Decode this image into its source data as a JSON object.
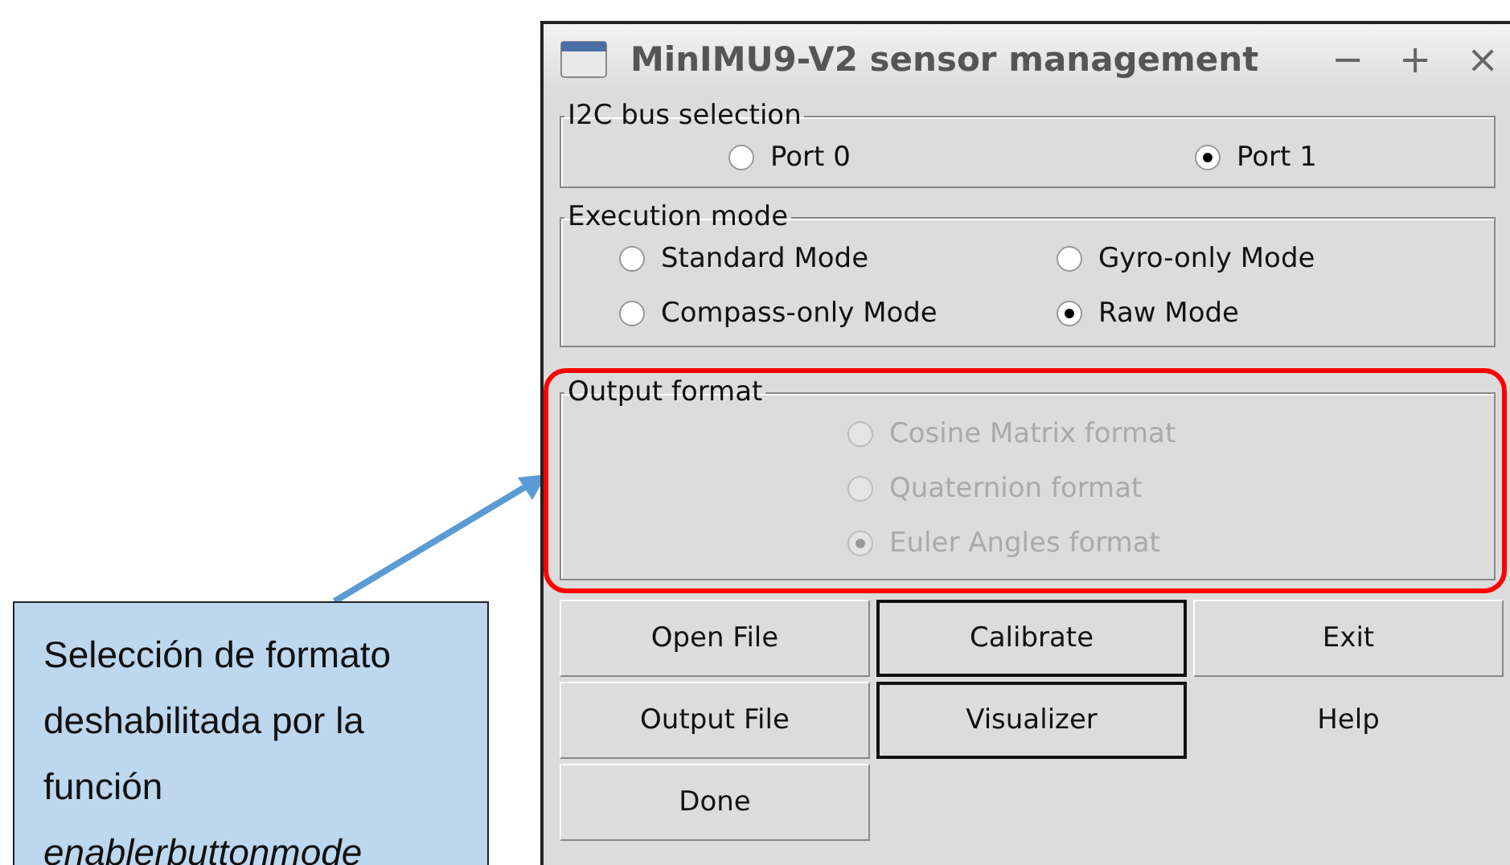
{
  "window": {
    "title": "MinIMU9-V2 sensor management",
    "controls": [
      "−",
      "+",
      "×"
    ]
  },
  "groups": [
    {
      "title": "I2C bus selection",
      "kind": "spread",
      "highlighted": false,
      "options": [
        {
          "label": "Port 0",
          "selected": false,
          "disabled": false
        },
        {
          "label": "Port 1",
          "selected": true,
          "disabled": false
        }
      ]
    },
    {
      "title": "Execution mode",
      "kind": "grid",
      "highlighted": false,
      "options": [
        {
          "label": "Standard Mode",
          "selected": false,
          "disabled": false
        },
        {
          "label": "Gyro-only Mode",
          "selected": false,
          "disabled": false
        },
        {
          "label": "Compass-only Mode",
          "selected": false,
          "disabled": false
        },
        {
          "label": "Raw Mode",
          "selected": true,
          "disabled": false
        }
      ]
    },
    {
      "title": "Output format",
      "kind": "column",
      "highlighted": true,
      "options": [
        {
          "label": "Cosine Matrix format",
          "selected": false,
          "disabled": true
        },
        {
          "label": "Quaternion format",
          "selected": false,
          "disabled": true
        },
        {
          "label": "Euler Angles format",
          "selected": true,
          "disabled": true
        }
      ]
    }
  ],
  "buttons": [
    {
      "label": "Open File",
      "kind": "raised"
    },
    {
      "label": "Calibrate",
      "kind": "framed"
    },
    {
      "label": "Exit",
      "kind": "raised"
    },
    {
      "label": "Output File",
      "kind": "raised"
    },
    {
      "label": "Visualizer",
      "kind": "framed"
    },
    {
      "label": "Help",
      "kind": "flat"
    },
    {
      "label": "Done",
      "kind": "raised"
    }
  ],
  "annotation": {
    "text": "Selección de formato deshabilitada por la función *enablerbuttonmode*"
  }
}
